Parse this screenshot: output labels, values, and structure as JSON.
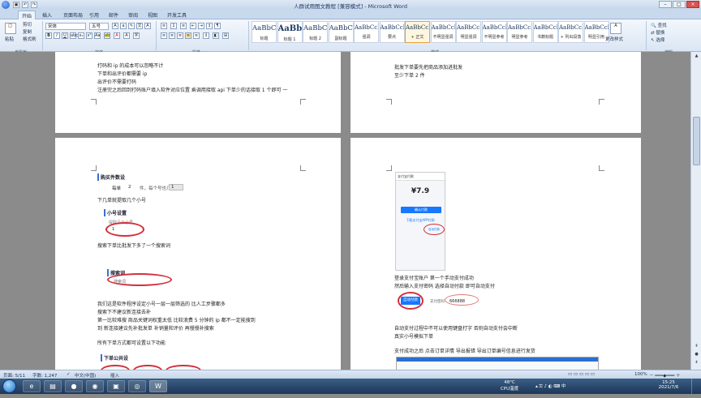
{
  "window": {
    "title": "人群试用图文教程 [兼容模式] - Microsoft Word",
    "controls": {
      "minimize": "–",
      "maximize": "□",
      "close": "×"
    }
  },
  "tabs": [
    "开始",
    "插入",
    "页面布局",
    "引用",
    "邮件",
    "审阅",
    "视图",
    "开发工具"
  ],
  "ribbon": {
    "clipboard": {
      "paste": "粘贴",
      "cut": "剪切",
      "copy": "复制",
      "format_painter": "格式刷",
      "label": "剪贴板"
    },
    "font": {
      "name": "宋体",
      "size": "五号",
      "label": "字体"
    },
    "paragraph": {
      "label": "段落"
    },
    "styles": {
      "label": "样式",
      "items": [
        {
          "sample": "AaBbC",
          "name": "标题"
        },
        {
          "sample": "AaBb",
          "name": "标题 1"
        },
        {
          "sample": "AaBbC",
          "name": "标题 2"
        },
        {
          "sample": "AaBbC",
          "name": "副标题"
        },
        {
          "sample": "AaBbCcD",
          "name": "强调"
        },
        {
          "sample": "AaBbCcD",
          "name": "要点"
        },
        {
          "sample": "AaBbCcDd",
          "name": "+ 正文"
        },
        {
          "sample": "AaBbCcD",
          "name": "不明显强调"
        },
        {
          "sample": "AaBbCcD",
          "name": "明显强调"
        },
        {
          "sample": "AaBbCcD",
          "name": "不明显参考"
        },
        {
          "sample": "AaBbCcI",
          "name": "明显参考"
        },
        {
          "sample": "AaBbCcI",
          "name": "书籍标题"
        },
        {
          "sample": "AaBbCcDd",
          "name": "+ 列出段落"
        },
        {
          "sample": "AaBbCcDd",
          "name": "明显引用"
        }
      ],
      "change_styles": "更改样式"
    },
    "editing": {
      "find": "查找",
      "replace": "替换",
      "select": "选择",
      "label": "编辑"
    }
  },
  "pages": {
    "top_left": {
      "lines": [
        "打码和 ip 的成本可以忽略不计",
        "下单和出评价都需要 ip",
        "出评价不需要打码",
        "注册完之后回到打码账户填入软件对应位置  乘调用接取 api 下单少的话接取 1 个即可  一"
      ]
    },
    "top_right": {
      "lines": [
        "批发下单要先把商品添加进批发",
        "至少下单 2 件"
      ]
    },
    "bottom_left": {
      "heading": "购买件数设",
      "buy_row": {
        "prefix": "每单",
        "qty": "2",
        "mid": "件，每个号也几单",
        "val": "1"
      },
      "lines": [
        "下几单就提取几个小号",
        "搜索下单比批发下多了一个搜索词",
        "我们这是软件程序设定小号一层一层筛选的      比人工步骤都多",
        "搜索下不建议新连接去补",
        "第一比较难搜   商品关键词权重太低   比较浪费   5 分钟的 ip 都不一定能搜到",
        "到    新连接建议先补批发单    补销量和评价    再慢慢补搜索",
        "所有下单方式都可设置以下功能"
      ],
      "subheads": [
        "小号设置",
        "搜索词",
        "下单公共设"
      ],
      "small_label": "提取几个小号",
      "small_value": "1",
      "search_label": "搜索词"
    },
    "bottom_right": {
      "phone": {
        "header": "支付宝付款",
        "amount": "¥7.9",
        "pay_btn": "确认付款",
        "link": "下载支付宝APP付款",
        "auto": "自动付款"
      },
      "lines": [
        "登录支付宝账户   第一个手动支付成功",
        "然后输入支付密码   选择自动付款   即可自动支付",
        "自动支付过程中不可以使用键盘打字   否则自动支付会中断",
        "真实小号模拟下单",
        "支付成功之后   点击订单详情        导出报错    导出订单编号信息进行发货"
      ],
      "auto_pay_btn": "自动付款",
      "pay_pwd_label": "支付密码",
      "pay_pwd_value": "666888"
    }
  },
  "statusbar": {
    "page": "页面: 5/11",
    "words": "字数: 1,247",
    "lang": "中文(中国)",
    "mode": "插入",
    "zoom": "100%"
  },
  "taskbar": {
    "temp": "48°C",
    "cpu": "CPU温度",
    "time": "15:25",
    "date": "2021/7/6"
  }
}
